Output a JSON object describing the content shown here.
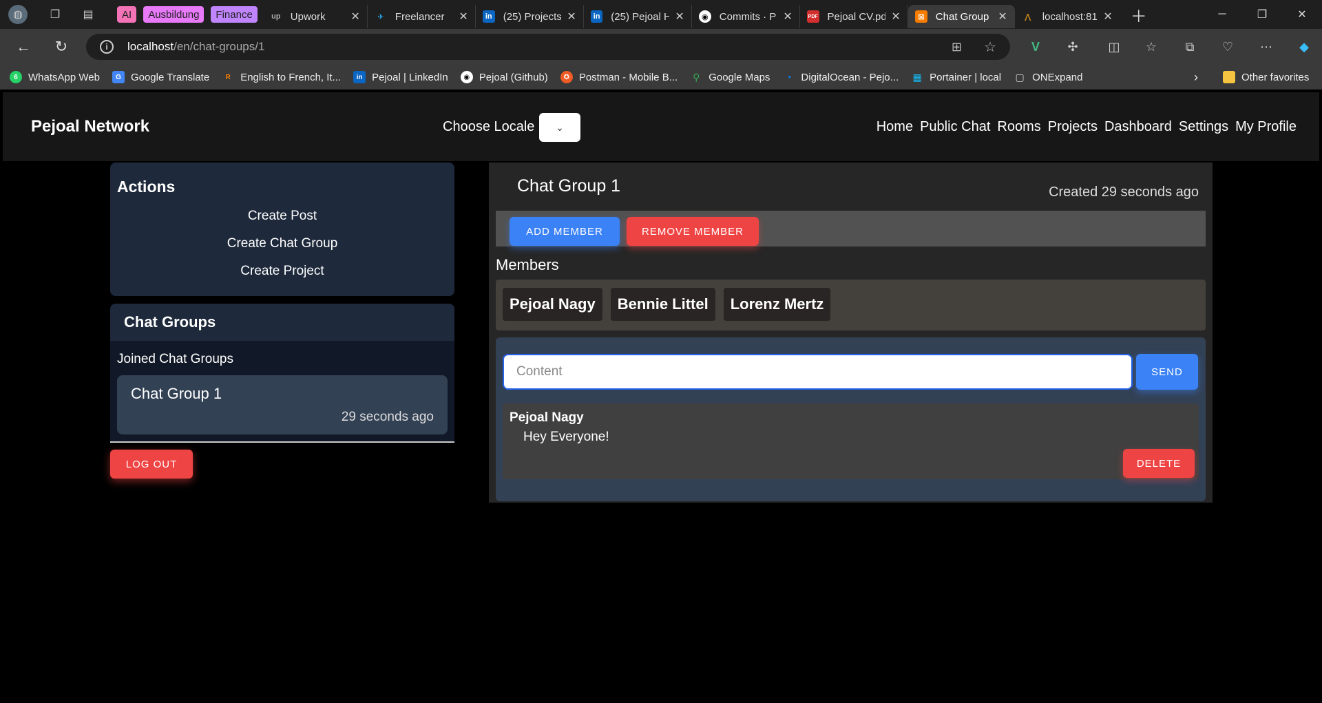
{
  "browser": {
    "tab_groups": [
      {
        "label": "AI",
        "color": "#f472b6"
      },
      {
        "label": "Ausbildung",
        "color": "#e879f9"
      },
      {
        "label": "Finance",
        "color": "#c084fc"
      }
    ],
    "tabs": [
      {
        "title": "Upwork",
        "icon": "upwork-icon",
        "fav": "up",
        "fav_color": "#1f1f1f"
      },
      {
        "title": "Freelancer",
        "icon": "freelancer-icon",
        "fav": "✈",
        "fav_color": "#29b2fe"
      },
      {
        "title": "(25) Projects",
        "icon": "linkedin-icon",
        "fav": "in",
        "fav_color": "#0a66c2"
      },
      {
        "title": "(25) Pejoal H",
        "icon": "linkedin-icon",
        "fav": "in",
        "fav_color": "#0a66c2"
      },
      {
        "title": "Commits · P",
        "icon": "github-icon",
        "fav": "◉",
        "fav_color": "#333"
      },
      {
        "title": "Pejoal CV.pd",
        "icon": "pdf-icon",
        "fav": "PDF",
        "fav_color": "#d32f2f"
      },
      {
        "title": "Chat Group",
        "icon": "xampp-icon",
        "fav": "⊠",
        "fav_color": "#f57c00",
        "active": true
      },
      {
        "title": "localhost:81",
        "icon": "tomcat-icon",
        "fav": "⋀",
        "fav_color": "#d08a1c"
      }
    ],
    "url_host": "localhost",
    "url_path": "/en/chat-groups/1",
    "bookmarks": [
      {
        "label": "WhatsApp Web",
        "fav": "6",
        "color": "#25d366"
      },
      {
        "label": "Google Translate",
        "fav": "G",
        "color": "#4285f4"
      },
      {
        "label": "English to French, It...",
        "fav": "R",
        "color": "#f57c00"
      },
      {
        "label": "Pejoal | LinkedIn",
        "fav": "in",
        "color": "#0a66c2"
      },
      {
        "label": "Pejoal (Github)",
        "fav": "◉",
        "color": "#333"
      },
      {
        "label": "Postman - Mobile B...",
        "fav": "✪",
        "color": "#ef5b25"
      },
      {
        "label": "Google Maps",
        "fav": "⚲",
        "color": "#34a853"
      },
      {
        "label": "DigitalOcean - Pejo...",
        "fav": "◔",
        "color": "#0080ff"
      },
      {
        "label": "Portainer | local",
        "fav": "▦",
        "color": "#13bef9"
      },
      {
        "label": "ONExpand",
        "fav": "▢",
        "color": "#555"
      }
    ],
    "other_favorites": "Other favorites"
  },
  "app": {
    "brand": "Pejoal Network",
    "locale_label": "Choose Locale",
    "nav": [
      "Home",
      "Public Chat",
      "Rooms",
      "Projects",
      "Dashboard",
      "Settings",
      "My Profile"
    ]
  },
  "sidebar": {
    "actions_title": "Actions",
    "actions": [
      "Create Post",
      "Create Chat Group",
      "Create Project"
    ],
    "groups_title": "Chat Groups",
    "joined_label": "Joined Chat Groups",
    "groups": [
      {
        "name": "Chat Group 1",
        "time": "29 seconds ago"
      }
    ],
    "logout": "LOG OUT"
  },
  "main": {
    "title": "Chat Group 1",
    "created": "Created 29 seconds ago",
    "add_member": "ADD MEMBER",
    "remove_member": "REMOVE MEMBER",
    "members_label": "Members",
    "members": [
      "Pejoal Nagy",
      "Bennie Littel",
      "Lorenz Mertz"
    ],
    "input_placeholder": "Content",
    "send": "SEND",
    "messages": [
      {
        "author": "Pejoal Nagy",
        "text": "Hey Everyone!",
        "delete": "DELETE"
      }
    ]
  }
}
